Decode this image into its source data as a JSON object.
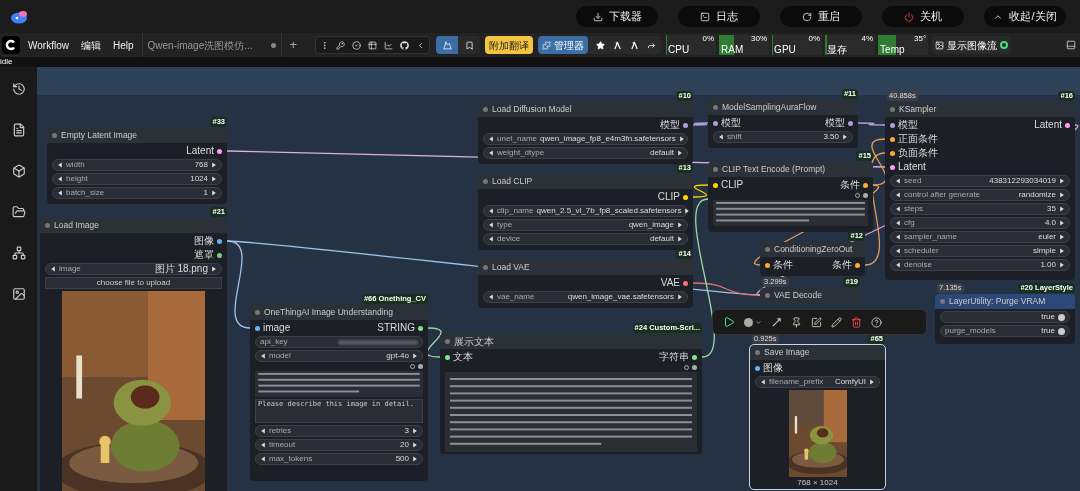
{
  "header": {
    "buttons": [
      {
        "label": "下载器",
        "kind": "download"
      },
      {
        "label": "日志",
        "kind": "log"
      },
      {
        "label": "重启",
        "kind": "restart"
      },
      {
        "label": "关机",
        "kind": "power"
      },
      {
        "label": "收起/关闭",
        "kind": "collapse"
      }
    ]
  },
  "menubar": {
    "menus": [
      "Workflow",
      "编辑",
      "Help"
    ],
    "tab": {
      "title": "Qwen-image洗图模仿...",
      "unsaved": true
    },
    "new_tab": "+",
    "translate_button": "附加翻译",
    "manager_button": "管理器",
    "meters": [
      {
        "label": "CPU",
        "reading": "0%",
        "level": 0
      },
      {
        "label": "RAM",
        "reading": "30%",
        "level": 0.3
      },
      {
        "label": "GPU",
        "reading": "0%",
        "level": 0
      },
      {
        "label": "显存",
        "reading": "4%",
        "level": 0.04
      },
      {
        "label": "Temp",
        "reading": "35°",
        "level": 0.35
      }
    ],
    "image_feed_button": "显示图像流"
  },
  "status": "idle",
  "nodes": [
    {
      "badge": "#33",
      "title": "Empty Latent Image",
      "selected": false,
      "outputs": [
        {
          "label": "Latent",
          "color": "#ff9cf9"
        }
      ],
      "widgets": [
        {
          "kind": "value",
          "label": "width",
          "value": "768"
        },
        {
          "kind": "value",
          "label": "height",
          "value": "1024"
        },
        {
          "kind": "value",
          "label": "batch_size",
          "value": "1"
        }
      ]
    },
    {
      "badge": "#21",
      "title": "Load Image",
      "selected": false,
      "outputs": [
        {
          "label": "图像",
          "color": "#64b5f6"
        },
        {
          "label": "遮罩",
          "color": "#81c784"
        }
      ],
      "widgets": [
        {
          "kind": "value",
          "label": "image",
          "value": "图片 18.png"
        },
        {
          "kind": "button",
          "label": "choose file to upload"
        },
        {
          "kind": "picture"
        }
      ]
    },
    {
      "badge": "#10",
      "title": "Load Diffusion Model",
      "selected": false,
      "outputs": [
        {
          "label": "模型",
          "color": "#b39ddb"
        }
      ],
      "widgets": [
        {
          "kind": "value",
          "label": "unet_name",
          "value": "qwen_image_fp8_e4m3fn.safetensors"
        },
        {
          "kind": "value",
          "label": "weight_dtype",
          "value": "default"
        }
      ]
    },
    {
      "badge": "#13",
      "title": "Load CLIP",
      "selected": false,
      "outputs": [
        {
          "label": "CLIP",
          "color": "#ffd500"
        }
      ],
      "widgets": [
        {
          "kind": "value",
          "label": "clip_name",
          "value": "qwen_2.5_vl_7b_fp8_scaled.safetensors"
        },
        {
          "kind": "value",
          "label": "type",
          "value": "qwen_image"
        },
        {
          "kind": "value",
          "label": "device",
          "value": "default"
        }
      ]
    },
    {
      "badge": "#14",
      "title": "Load VAE",
      "selected": false,
      "outputs": [
        {
          "label": "VAE",
          "color": "#ff6e6e"
        }
      ],
      "widgets": [
        {
          "kind": "value",
          "label": "vae_name",
          "value": "qwen_image_vae.safetensors"
        }
      ]
    },
    {
      "badge": "#11",
      "title": "ModelSamplingAuraFlow",
      "selected": false,
      "inputs": [
        {
          "label": "模型",
          "color": "#b39ddb"
        }
      ],
      "outputs": [
        {
          "label": "模型",
          "color": "#b39ddb"
        }
      ],
      "widgets": [
        {
          "kind": "value",
          "label": "shift",
          "value": "3.50"
        }
      ]
    },
    {
      "badge": "#15",
      "title": "CLIP Text Encode (Prompt)",
      "selected": false,
      "inputs": [
        {
          "label": "CLIP",
          "color": "#ffd500"
        }
      ],
      "outputs": [
        {
          "label": "条件",
          "color": "#ffa931"
        }
      ],
      "widgets": [
        {
          "kind": "lines"
        }
      ]
    },
    {
      "badge": "#12",
      "title": "ConditioningZeroOut",
      "selected": false,
      "inputs": [
        {
          "label": "条件",
          "color": "#ffa931"
        }
      ],
      "outputs": [
        {
          "label": "条件",
          "color": "#ffa931"
        }
      ]
    },
    {
      "badge": "#16",
      "time": "40.858s",
      "title": "KSampler",
      "selected": false,
      "inputs": [
        {
          "label": "模型",
          "color": "#b39ddb"
        },
        {
          "label": "正面条件",
          "color": "#ffa931"
        },
        {
          "label": "负面条件",
          "color": "#ffa931"
        },
        {
          "label": "Latent",
          "color": "#ff9cf9"
        }
      ],
      "outputs": [
        {
          "label": "Latent",
          "color": "#ff9cf9"
        }
      ],
      "widgets": [
        {
          "kind": "value",
          "label": "seed",
          "value": "438312293034019"
        },
        {
          "kind": "value",
          "label": "control after generate",
          "value": "randomize"
        },
        {
          "kind": "value",
          "label": "steps",
          "value": "35"
        },
        {
          "kind": "value",
          "label": "cfg",
          "value": "4.0"
        },
        {
          "kind": "value",
          "label": "sampler_name",
          "value": "euler"
        },
        {
          "kind": "value",
          "label": "scheduler",
          "value": "simple"
        },
        {
          "kind": "value",
          "label": "denoise",
          "value": "1.00"
        }
      ]
    },
    {
      "badge": "#19",
      "time": "3.299s",
      "title": "VAE Decode",
      "selected": false
    },
    {
      "badge": "#20 LayerStyle",
      "time": "7.135s",
      "title": "LayerUtility: Purge VRAM",
      "selected": false,
      "widgets": [
        {
          "kind": "toggle",
          "value": "true"
        },
        {
          "kind": "toggle",
          "label": "purge_models",
          "value": "true"
        }
      ]
    },
    {
      "badge": "#66 Onething_CV",
      "title": "OneThingAI Image Understanding",
      "selected": false,
      "inputs": [
        {
          "label": "image",
          "color": "#64b5f6"
        }
      ],
      "outputs": [
        {
          "label": "STRING",
          "color": "#7ee787"
        }
      ],
      "widgets": [
        {
          "kind": "secret",
          "label": "api_key"
        },
        {
          "kind": "value",
          "label": "model",
          "value": "gpt-4o"
        },
        {
          "kind": "lines"
        },
        {
          "kind": "textarea",
          "value": "Please describe this image in detail."
        },
        {
          "kind": "value",
          "label": "retries",
          "value": "3"
        },
        {
          "kind": "value",
          "label": "timeout",
          "value": "20"
        },
        {
          "kind": "value",
          "label": "max_tokens",
          "value": "500"
        }
      ]
    },
    {
      "badge": "#24 Custom-Scri...",
      "title": "展示文本",
      "selected": false,
      "inputs": [
        {
          "label": "文本",
          "color": "#7ee787"
        }
      ],
      "outputs": [
        {
          "label": "字符串",
          "color": "#7ee787"
        }
      ],
      "widgets": [
        {
          "kind": "lines"
        }
      ]
    },
    {
      "badge": "#65",
      "time": "0.925s",
      "title": "Save Image",
      "selected": true,
      "inputs": [
        {
          "label": "图像",
          "color": "#64b5f6"
        }
      ],
      "widgets": [
        {
          "kind": "value",
          "label": "filename_prefix",
          "value": "ComfyUI"
        },
        {
          "kind": "picture"
        },
        {
          "kind": "caption",
          "value": "768 × 1024"
        }
      ]
    }
  ]
}
